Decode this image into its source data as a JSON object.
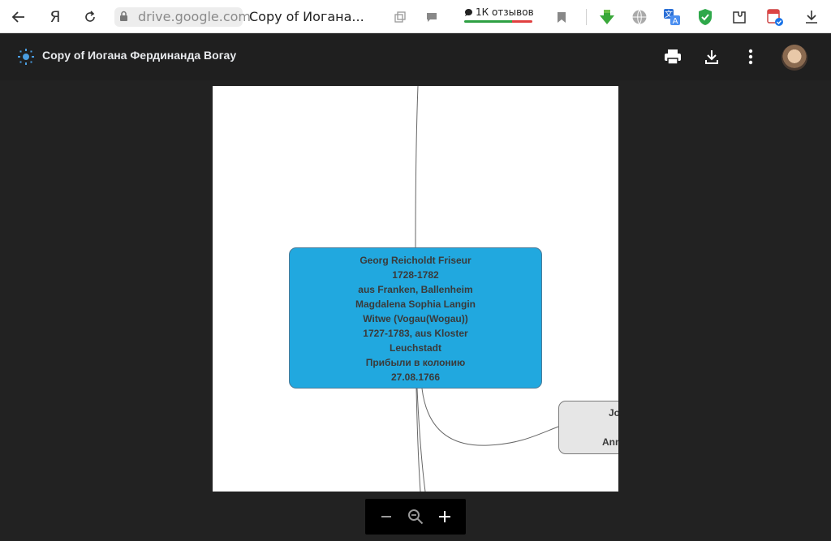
{
  "browser": {
    "domain": "drive.google.com",
    "tab_title": "Copy of Иогана...",
    "reviews_label": "1К отзывов",
    "icons": [
      "back-icon",
      "yandex-icon",
      "reload-icon",
      "lock-icon",
      "tab-switch-icon",
      "comment-icon",
      "bookmark-icon",
      "download-ext-icon",
      "globe-icon",
      "translate-icon",
      "shield-icon",
      "extension-icon",
      "calendar-icon",
      "download-icon"
    ]
  },
  "header": {
    "title": "Copy of Иогана Фердинанда Вогау",
    "actions": [
      "print-icon",
      "download-icon",
      "more-vert-icon"
    ]
  },
  "page": {
    "main_node": {
      "lines": [
        "Georg Reicholdt Friseur",
        "1728-1782",
        "aus Franken, Ballenheim",
        "Magdalena Sophia Langin",
        "Witwe (Vogau(Wogau))",
        "1727-1783, aus Kloster",
        "Leuchstadt",
        "Прибыли в колонию",
        "27.08.1766"
      ]
    },
    "side_node": {
      "line1": "Jo",
      "line2": "Ann"
    }
  },
  "zoom": {
    "controls": [
      "zoom-out-icon",
      "zoom-reset-icon",
      "zoom-in-icon"
    ]
  },
  "colors": {
    "node_main_fill": "#21a8df",
    "node_side_fill": "#e6e6e6",
    "header_bg": "#1f1f1f",
    "viewer_bg": "#222222"
  }
}
